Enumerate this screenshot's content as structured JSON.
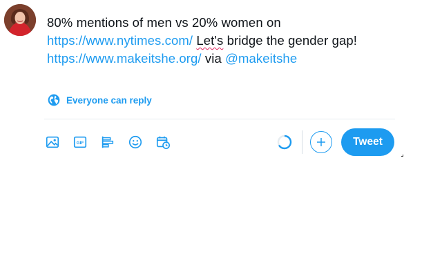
{
  "tweet": {
    "part1": "80% mentions of men vs 20% women on",
    "link1": "https://www.nytimes.com/",
    "part2_misspelled": "Let's",
    "part2_rest": " bridge the gender gap!",
    "link2": "https://www.makeitshe.org/",
    "via": " via ",
    "mention": "@makeitshe"
  },
  "reply_setting": {
    "label": "Everyone can reply",
    "icon": "globe-icon"
  },
  "toolbar": {
    "icons": [
      "image-icon",
      "gif-icon",
      "poll-icon",
      "emoji-icon",
      "schedule-icon"
    ],
    "gif_text": "GIF"
  },
  "actions": {
    "tweet_label": "Tweet",
    "add_icon": "plus-icon"
  },
  "colors": {
    "accent": "#1d9bf0",
    "text": "#0f1419",
    "divider": "#e6ecf0",
    "misspell": "#e0245e"
  }
}
